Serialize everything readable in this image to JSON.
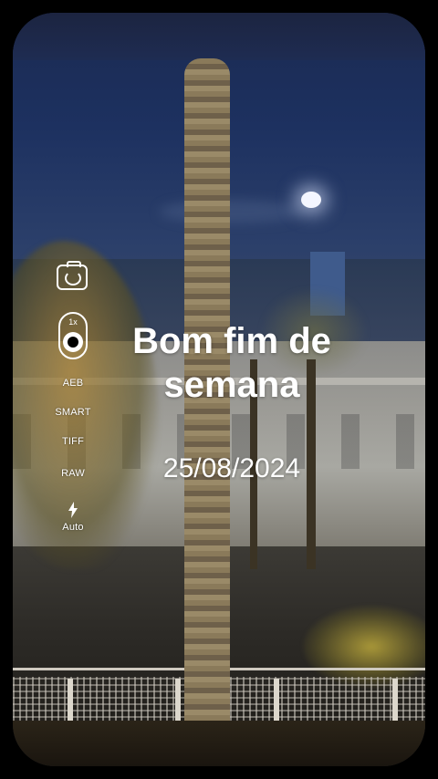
{
  "overlay": {
    "headline": "Bom fim de semana",
    "date": "25/08/2024"
  },
  "camera_controls": {
    "switch_camera_icon": "camera-switch-icon",
    "lens_zoom": "1x",
    "options": [
      "AEB",
      "SMART",
      "TIFF",
      "RAW"
    ],
    "flash_icon": "flash-icon",
    "flash_mode": "Auto"
  },
  "colors": {
    "text": "#ffffff",
    "background": "#000000"
  }
}
